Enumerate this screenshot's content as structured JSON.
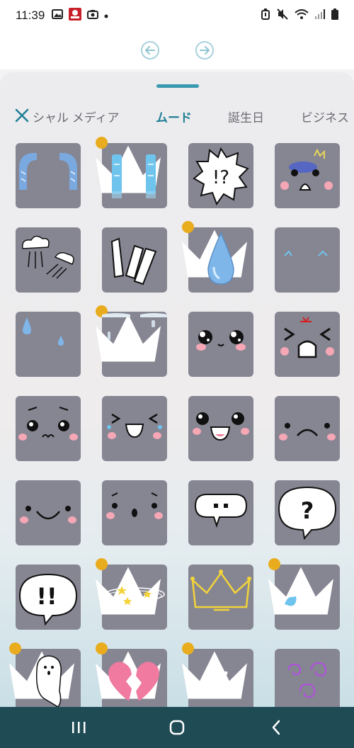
{
  "status_bar": {
    "time": "11:39",
    "left_icons": [
      "image-icon",
      "app-notification-icon",
      "camera-icon",
      "dot-icon"
    ],
    "right_icons": [
      "alarm-icon",
      "mute-icon",
      "wifi-icon",
      "signal-icon",
      "battery-icon"
    ]
  },
  "toolbar": {
    "undo_icon": "undo-icon",
    "redo_icon": "redo-icon"
  },
  "tabs": [
    {
      "label": "シャル メディア",
      "active": false
    },
    {
      "label": "ムード",
      "active": true
    },
    {
      "label": "誕生日",
      "active": false
    },
    {
      "label": "ビジネス",
      "active": false
    }
  ],
  "stickers": [
    {
      "name": "tears-streaming",
      "premium": false
    },
    {
      "name": "tears-falling",
      "premium": true
    },
    {
      "name": "exclaim-question-burst",
      "premium": false
    },
    {
      "name": "shocked-face",
      "premium": false
    },
    {
      "name": "steam-puffs",
      "premium": false
    },
    {
      "name": "shock-lines",
      "premium": false
    },
    {
      "name": "water-drop",
      "premium": true
    },
    {
      "name": "small-tears",
      "premium": false
    },
    {
      "name": "sweat-drops",
      "premium": false
    },
    {
      "name": "frozen-drips",
      "premium": true
    },
    {
      "name": "sparkly-eyes",
      "premium": false
    },
    {
      "name": "angry-face",
      "premium": false
    },
    {
      "name": "teary-sad-face",
      "premium": false
    },
    {
      "name": "laughing-face",
      "premium": false
    },
    {
      "name": "happy-sparkle-face",
      "premium": false
    },
    {
      "name": "frown-face",
      "premium": false
    },
    {
      "name": "smile-face",
      "premium": false
    },
    {
      "name": "surprised-face",
      "premium": false
    },
    {
      "name": "ellipsis-bubble",
      "premium": false
    },
    {
      "name": "question-bubble",
      "premium": false
    },
    {
      "name": "exclaim-bubble",
      "premium": false
    },
    {
      "name": "dizzy-stars",
      "premium": true
    },
    {
      "name": "crown",
      "premium": false
    },
    {
      "name": "small-ghost",
      "premium": true
    },
    {
      "name": "ghost",
      "premium": true
    },
    {
      "name": "broken-heart",
      "premium": true
    },
    {
      "name": "sleep-z",
      "premium": true
    },
    {
      "name": "dizzy-swirls",
      "premium": false
    }
  ],
  "text": {
    "bubble_q": "?",
    "bubble_excl": "!!",
    "burst": "!?",
    "z": "Z"
  },
  "nav_bar": {
    "icons": [
      "recent-apps-icon",
      "home-icon",
      "back-icon"
    ]
  },
  "colors": {
    "accent": "#1f7f96",
    "tile": "#868592",
    "premium_badge": "#e9ac1f",
    "nav_bar": "#1f4b55"
  }
}
